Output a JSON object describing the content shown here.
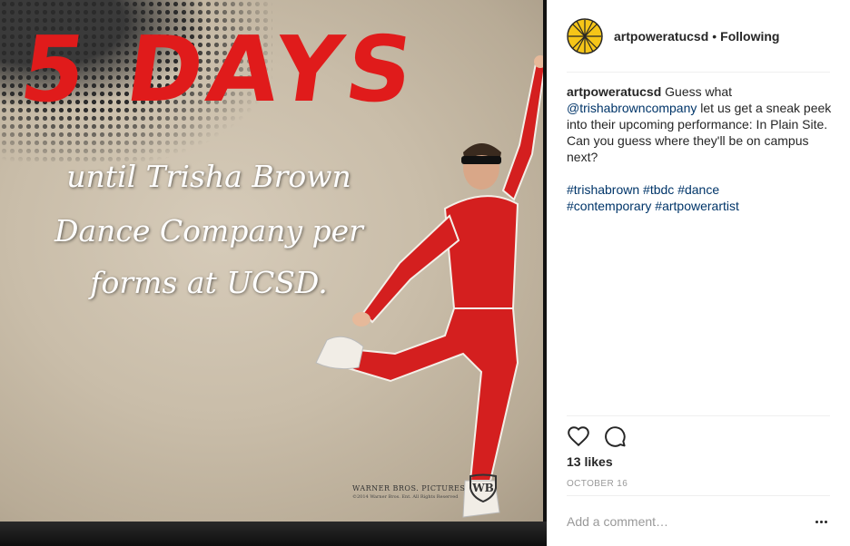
{
  "post": {
    "image_headline": "5 DAYS",
    "image_lines": [
      "until Trisha Brown",
      "Dance Company per",
      "forms at UCSD."
    ],
    "image_credit": "WARNER BROS. PICTURES",
    "image_credit_small": "©2014 Warner Bros. Ent. All Rights Reserved"
  },
  "header": {
    "username": "artpoweratucsd",
    "separator": "•",
    "follow_status": "Following"
  },
  "caption": {
    "username": "artpoweratucsd",
    "text_before_mention": "Guess what",
    "mention": "@trishabrowncompany",
    "text_after_mention": "let us get a sneak peek into their upcoming performance: In Plain Site. Can you guess where they'll be on campus next?",
    "hashtags_line1": [
      "#trishabrown",
      "#tbdc",
      "#dance"
    ],
    "hashtags_line2": [
      "#contemporary",
      "#artpowerartist"
    ]
  },
  "actions": {
    "like_icon": "heart-icon",
    "comment_icon": "comment-bubble-icon"
  },
  "likes": "13 likes",
  "date": "OCTOBER 16",
  "comment": {
    "placeholder": "Add a comment…",
    "more_icon": "more-options-icon"
  },
  "colors": {
    "headline_red": "#e01b1b",
    "avatar_yellow": "#f5c518",
    "link_blue": "#003569",
    "muted_gray": "#999999"
  }
}
